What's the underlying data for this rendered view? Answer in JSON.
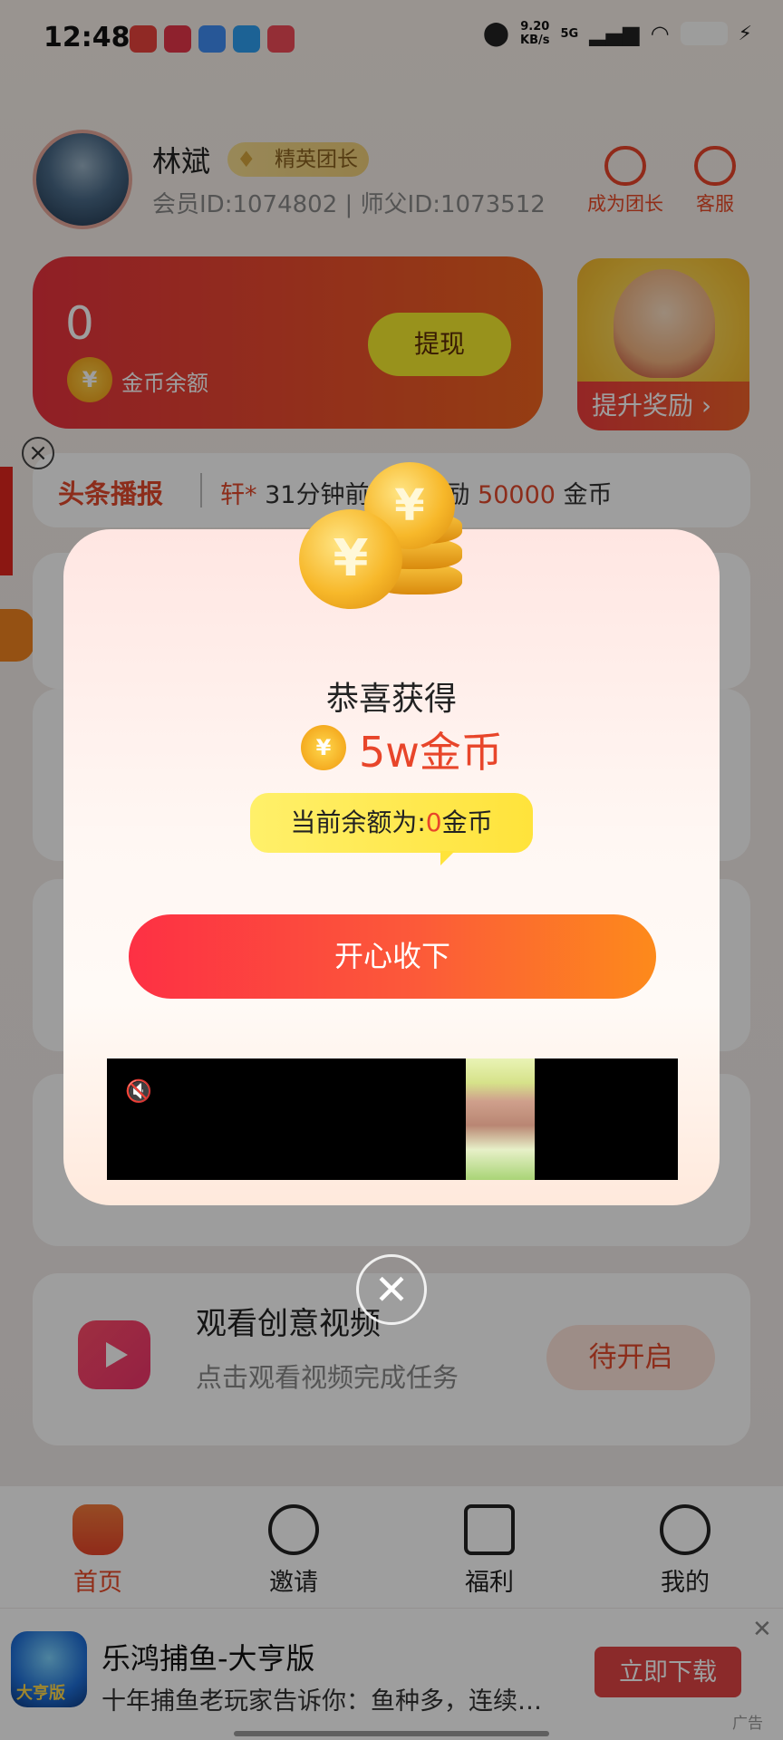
{
  "status_bar": {
    "time": "12:48",
    "speed_value": "9.20",
    "speed_unit": "KB/s",
    "network": "5G",
    "notification_icons": [
      "app-icon-red",
      "app-icon-red",
      "app-icon-blue",
      "app-icon-blue",
      "app-icon-red"
    ]
  },
  "profile": {
    "name": "林斌",
    "badge": "精英团长",
    "ids": "会员ID:1074802 | 师父ID:1073512",
    "become_leader": "成为团长",
    "customer_service": "客服"
  },
  "wallet": {
    "balance": "0",
    "coin_symbol": "¥",
    "balance_label": "金币余额",
    "withdraw": "提现"
  },
  "reward_card": {
    "label": "提升奖励",
    "chevron": "›"
  },
  "ticker": {
    "title": "头条播报",
    "user": "轩*",
    "text": "31分钟前",
    "text2": "励",
    "amount": "50000",
    "unit": "金币"
  },
  "task": {
    "title": "观看创意视频",
    "subtitle": "点击观看视频完成任务",
    "button": "待开启"
  },
  "popup": {
    "title": "恭喜获得",
    "coin_symbol": "¥",
    "amount": "5w金币",
    "balance_prefix": "当前余额为:",
    "balance_value": "0",
    "balance_suffix": "金币",
    "button": "开心收下",
    "close": "✕"
  },
  "nav": {
    "items": [
      {
        "label": "首页",
        "icon": "home-icon"
      },
      {
        "label": "邀请",
        "icon": "invite-icon"
      },
      {
        "label": "福利",
        "icon": "gift-icon"
      },
      {
        "label": "我的",
        "icon": "profile-icon"
      }
    ],
    "active_index": 0
  },
  "ad": {
    "icon_text": "大亨版",
    "title": "乐鸿捕鱼-大亨版",
    "description": "十年捕鱼老玩家告诉你：鱼种多，连续…",
    "button": "立即下载",
    "close": "✕",
    "tag": "广告"
  },
  "colors": {
    "accent": "#e8452a",
    "wallet_start": "#e8323e",
    "wallet_end": "#f0641f",
    "withdraw_button": "#f6ec2e",
    "popup_button_start": "#fd3044",
    "popup_button_end": "#fd8a1b"
  }
}
